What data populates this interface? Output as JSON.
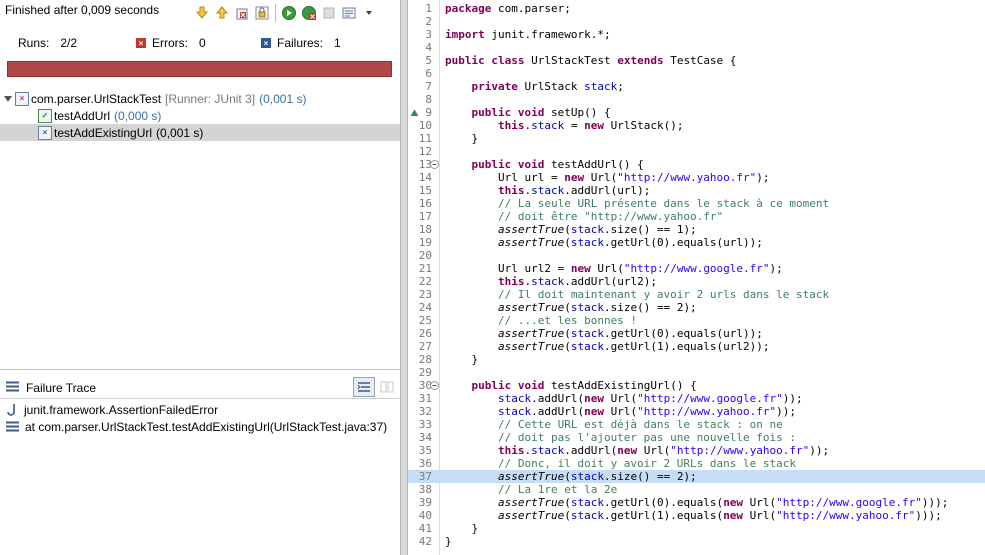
{
  "junit": {
    "status": "Finished after 0,009 seconds",
    "runs_label": "Runs:",
    "runs_value": "2/2",
    "errors_label": "Errors:",
    "errors_value": "0",
    "failures_label": "Failures:",
    "failures_value": "1",
    "progress_color": "#b0484a",
    "progress_fraction": 1.0,
    "tree": {
      "suite": "com.parser.UrlStackTest",
      "suite_meta": "[Runner: JUnit 3]",
      "suite_time": "(0,001 s)",
      "tests": [
        {
          "name": "testAddUrl",
          "time": "(0,000 s)",
          "result": "passed"
        },
        {
          "name": "testAddExistingUrl",
          "time": "(0,001 s)",
          "result": "failed"
        }
      ]
    },
    "failure_trace": {
      "title": "Failure Trace",
      "lines": [
        "junit.framework.AssertionFailedError",
        "at com.parser.UrlStackTest.testAddExistingUrl(UrlStackTest.java:37)"
      ]
    }
  },
  "editor": {
    "highlight_line": "37",
    "lines": [
      {
        "n": "1"
      },
      {
        "n": "2"
      },
      {
        "n": "3"
      },
      {
        "n": "4"
      },
      {
        "n": "5"
      },
      {
        "n": "6"
      },
      {
        "n": "7"
      },
      {
        "n": "8"
      },
      {
        "n": "9"
      },
      {
        "n": "10"
      },
      {
        "n": "11"
      },
      {
        "n": "12"
      },
      {
        "n": "13"
      },
      {
        "n": "14"
      },
      {
        "n": "15"
      },
      {
        "n": "16"
      },
      {
        "n": "17"
      },
      {
        "n": "18"
      },
      {
        "n": "19"
      },
      {
        "n": "20"
      },
      {
        "n": "21"
      },
      {
        "n": "22"
      },
      {
        "n": "23"
      },
      {
        "n": "24"
      },
      {
        "n": "25"
      },
      {
        "n": "26"
      },
      {
        "n": "27"
      },
      {
        "n": "28"
      },
      {
        "n": "29"
      },
      {
        "n": "30"
      },
      {
        "n": "31"
      },
      {
        "n": "32"
      },
      {
        "n": "33"
      },
      {
        "n": "34"
      },
      {
        "n": "35"
      },
      {
        "n": "36"
      },
      {
        "n": "37"
      },
      {
        "n": "38"
      },
      {
        "n": "39"
      },
      {
        "n": "40"
      },
      {
        "n": "41"
      },
      {
        "n": "42"
      }
    ],
    "tok": {
      "l1": [
        "package",
        " com.parser;"
      ],
      "l3": [
        "import",
        " junit.framework.*;"
      ],
      "l5": [
        "public",
        " ",
        "class",
        " UrlStackTest ",
        "extends",
        " TestCase {"
      ],
      "l7": [
        "    ",
        "private",
        " UrlStack ",
        "stack",
        ";"
      ],
      "l9": [
        "    ",
        "public",
        " ",
        "void",
        " setUp() {"
      ],
      "l10": [
        "        ",
        "this",
        ".",
        "stack",
        " = ",
        "new",
        " UrlStack();"
      ],
      "l11": [
        "    }"
      ],
      "l13": [
        "    ",
        "public",
        " ",
        "void",
        " testAddUrl() {"
      ],
      "l14": [
        "        Url url = ",
        "new",
        " Url(",
        "\"http://www.yahoo.fr\"",
        ");"
      ],
      "l15": [
        "        ",
        "this",
        ".",
        "stack",
        ".addUrl(url);"
      ],
      "l16": [
        "        // La seule URL présente dans le stack à ce moment"
      ],
      "l17": [
        "        // doit être \"http://www.yahoo.fr\""
      ],
      "l18": [
        "        ",
        "assertTrue",
        "(",
        "stack",
        ".size() == 1);"
      ],
      "l19": [
        "        ",
        "assertTrue",
        "(",
        "stack",
        ".getUrl(0).equals(url));"
      ],
      "l21": [
        "        Url url2 = ",
        "new",
        " Url(",
        "\"http://www.google.fr\"",
        ");"
      ],
      "l22": [
        "        ",
        "this",
        ".",
        "stack",
        ".addUrl(url2);"
      ],
      "l23": [
        "        // Il doit maintenant y avoir 2 urls dans le stack"
      ],
      "l24": [
        "        ",
        "assertTrue",
        "(",
        "stack",
        ".size() == 2);"
      ],
      "l25": [
        "        // ...et les bonnes !"
      ],
      "l26": [
        "        ",
        "assertTrue",
        "(",
        "stack",
        ".getUrl(0).equals(url));"
      ],
      "l27": [
        "        ",
        "assertTrue",
        "(",
        "stack",
        ".getUrl(1).equals(url2));"
      ],
      "l28": [
        "    }"
      ],
      "l30": [
        "    ",
        "public",
        " ",
        "void",
        " testAddExistingUrl() {"
      ],
      "l31": [
        "        ",
        "stack",
        ".addUrl(",
        "new",
        " Url(",
        "\"http://www.google.fr\"",
        "));"
      ],
      "l32": [
        "        ",
        "stack",
        ".addUrl(",
        "new",
        " Url(",
        "\"http://www.yahoo.fr\"",
        "));"
      ],
      "l33": [
        "        // Cette URL est déjà dans le stack : on ne"
      ],
      "l34": [
        "        // doit pas l'ajouter pas une nouvelle fois :"
      ],
      "l35": [
        "        ",
        "this",
        ".",
        "stack",
        ".addUrl(",
        "new",
        " Url(",
        "\"http://www.yahoo.fr\"",
        "));"
      ],
      "l36": [
        "        // Donc, il doit y avoir 2 URLs dans le stack"
      ],
      "l37": [
        "        ",
        "assertTrue",
        "(",
        "stack",
        ".size() == 2);"
      ],
      "l38": [
        "        // La 1re et la 2e"
      ],
      "l39": [
        "        ",
        "assertTrue",
        "(",
        "stack",
        ".getUrl(0).equals(",
        "new",
        " Url(",
        "\"http://www.google.fr\"",
        ")));"
      ],
      "l40": [
        "        ",
        "assertTrue",
        "(",
        "stack",
        ".getUrl(1).equals(",
        "new",
        " Url(",
        "\"http://www.yahoo.fr\"",
        ")));"
      ],
      "l41": [
        "    }"
      ],
      "l42": [
        "}"
      ]
    }
  }
}
